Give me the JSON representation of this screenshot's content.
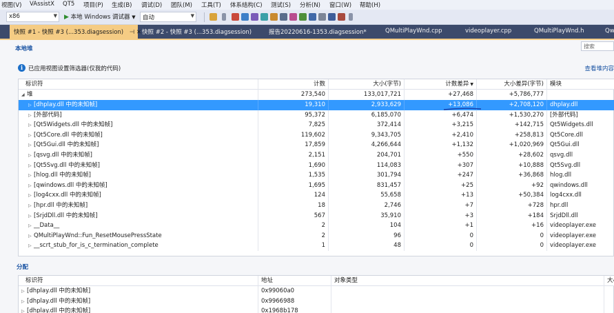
{
  "menu": [
    "视图(V)",
    "VAssistX",
    "QT5",
    "项目(P)",
    "生成(B)",
    "调试(D)",
    "团队(M)",
    "工具(T)",
    "体系结构(C)",
    "测试(S)",
    "分析(N)",
    "窗口(W)",
    "帮助(H)"
  ],
  "toolbar": {
    "platform": "x86",
    "run_label": "本地 Windows 调试器",
    "mode": "自动"
  },
  "tabs": [
    {
      "label": "快照 #1 - 快照 #3 (...353.diagsession)",
      "active": true
    },
    {
      "label": "快照 #2 - 快照 #3 (...353.diagsession)",
      "active": false
    },
    {
      "label": "报告20220616-1353.diagsession*",
      "active": false
    },
    {
      "label": "QMultiPlayWnd.cpp",
      "active": false
    },
    {
      "label": "videoplayer.cpp",
      "active": false
    },
    {
      "label": "QMultiPlayWnd.h",
      "active": false
    },
    {
      "label": "Qw",
      "active": false
    }
  ],
  "panel": {
    "title": "本地堆",
    "search_placeholder": "搜索",
    "info_text": "已应用视图设置筛选器(仅我的代码)",
    "info_link": "查看堆内容"
  },
  "heap_table": {
    "columns": [
      "标识符",
      "计数",
      "大小(字节)",
      "计数差异",
      "大小差异(字节)",
      "模块"
    ],
    "root": {
      "name": "堆",
      "count": "273,540",
      "size": "133,017,721",
      "count_diff": "+27,468",
      "size_diff": "+5,786,777",
      "module": ""
    },
    "rows": [
      {
        "name": "[dhplay.dll 中的未知帧]",
        "count": "19,310",
        "size": "2,933,629",
        "count_diff": "+13,086",
        "size_diff": "+2,708,120",
        "module": "dhplay.dll",
        "selected": true
      },
      {
        "name": "[外部代码]",
        "count": "95,372",
        "size": "6,185,070",
        "count_diff": "+6,474",
        "size_diff": "+1,530,270",
        "module": "[外部代码]"
      },
      {
        "name": "[Qt5Widgets.dll 中的未知帧]",
        "count": "7,825",
        "size": "372,414",
        "count_diff": "+3,215",
        "size_diff": "+142,715",
        "module": "Qt5Widgets.dll"
      },
      {
        "name": "[Qt5Core.dll 中的未知帧]",
        "count": "119,602",
        "size": "9,343,705",
        "count_diff": "+2,410",
        "size_diff": "+258,813",
        "module": "Qt5Core.dll"
      },
      {
        "name": "[Qt5Gui.dll 中的未知帧]",
        "count": "17,859",
        "size": "4,266,644",
        "count_diff": "+1,132",
        "size_diff": "+1,020,969",
        "module": "Qt5Gui.dll"
      },
      {
        "name": "[qsvg.dll 中的未知帧]",
        "count": "2,151",
        "size": "204,701",
        "count_diff": "+550",
        "size_diff": "+28,602",
        "module": "qsvg.dll"
      },
      {
        "name": "[Qt5Svg.dll 中的未知帧]",
        "count": "1,690",
        "size": "114,083",
        "count_diff": "+307",
        "size_diff": "+10,888",
        "module": "Qt5Svg.dll"
      },
      {
        "name": "[hlog.dll 中的未知帧]",
        "count": "1,535",
        "size": "301,794",
        "count_diff": "+247",
        "size_diff": "+36,868",
        "module": "hlog.dll"
      },
      {
        "name": "[qwindows.dll 中的未知帧]",
        "count": "1,695",
        "size": "831,457",
        "count_diff": "+25",
        "size_diff": "+92",
        "module": "qwindows.dll"
      },
      {
        "name": "[log4cxx.dll 中的未知帧]",
        "count": "124",
        "size": "55,658",
        "count_diff": "+13",
        "size_diff": "+50,384",
        "module": "log4cxx.dll"
      },
      {
        "name": "[hpr.dll 中的未知帧]",
        "count": "18",
        "size": "2,746",
        "count_diff": "+7",
        "size_diff": "+728",
        "module": "hpr.dll"
      },
      {
        "name": "[SrjdDll.dll 中的未知帧]",
        "count": "567",
        "size": "35,910",
        "count_diff": "+3",
        "size_diff": "+184",
        "module": "SrjdDll.dll"
      },
      {
        "name": "__Data__",
        "count": "2",
        "size": "104",
        "count_diff": "+1",
        "size_diff": "+16",
        "module": "videoplayer.exe"
      },
      {
        "name": "QMultiPlayWnd::Fun_ResetMousePressState",
        "count": "2",
        "size": "96",
        "count_diff": "0",
        "size_diff": "0",
        "module": "videoplayer.exe"
      },
      {
        "name": "__scrt_stub_for_is_c_termination_complete",
        "count": "1",
        "size": "48",
        "count_diff": "0",
        "size_diff": "0",
        "module": "videoplayer.exe"
      }
    ]
  },
  "alloc_section": {
    "title": "分配",
    "columns": [
      "标识符",
      "地址",
      "对象类型",
      "大小"
    ],
    "rows": [
      {
        "name": "[dhplay.dll 中的未知帧]",
        "address": "0x99060a0"
      },
      {
        "name": "[dhplay.dll 中的未知帧]",
        "address": "0x9966988"
      },
      {
        "name": "[dhplay.dll 中的未知帧]",
        "address": "0x1968b178"
      }
    ]
  },
  "colors": {
    "selected_row": "#3399ff",
    "tab_strip": "#3c4a6b",
    "active_tab": "#f5cc84",
    "link": "#1b54a3"
  },
  "icons": [
    "play-icon",
    "info-icon",
    "caret-right-icon",
    "caret-down-icon",
    "sort-desc-icon"
  ]
}
